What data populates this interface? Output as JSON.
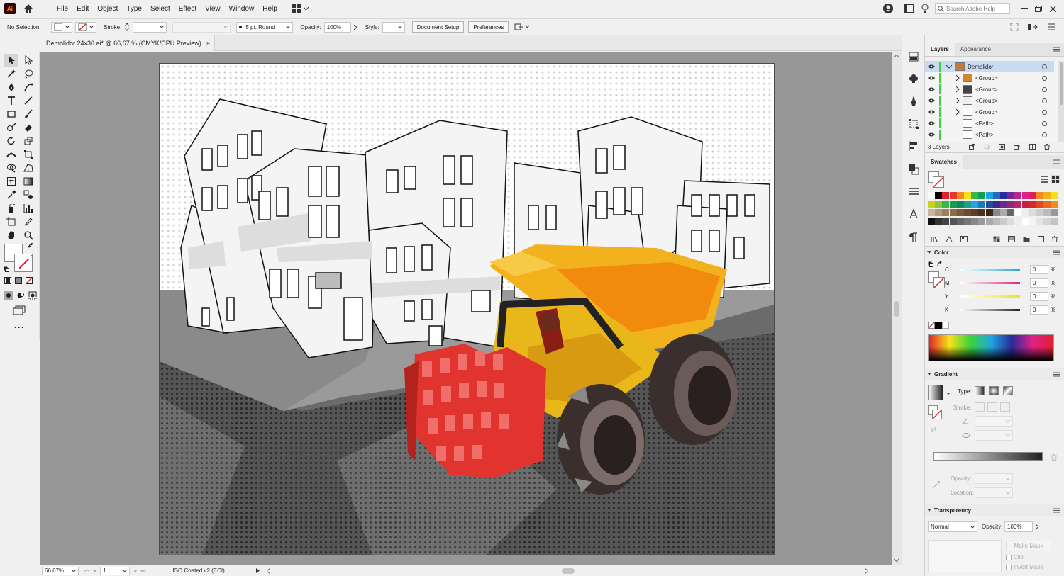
{
  "app": {
    "logo": "Ai"
  },
  "menu": [
    "File",
    "Edit",
    "Object",
    "Type",
    "Select",
    "Effect",
    "View",
    "Window",
    "Help"
  ],
  "search": {
    "placeholder": "Search Adobe Help"
  },
  "control": {
    "selection": "No Selection",
    "stroke_label": "Stroke:",
    "brush": "5 pt. Round",
    "opacity_label": "Opacity:",
    "opacity": "100%",
    "style_label": "Style:",
    "doc_setup": "Document Setup",
    "preferences": "Preferences"
  },
  "document": {
    "tab_title": "Demolidor 24x30.ai* @ 66,67 % (CMYK/CPU Preview)",
    "close": "×"
  },
  "status": {
    "zoom": "66,67%",
    "artboard": "1",
    "profile": "ISO Coated v2 (ECI)"
  },
  "layers_panel": {
    "tabs": [
      "Layers",
      "Appearance"
    ],
    "rows": [
      {
        "name": "Demolidor"
      },
      {
        "name": "<Group>"
      },
      {
        "name": "<Group>"
      },
      {
        "name": "<Group>"
      },
      {
        "name": "<Group>"
      },
      {
        "name": "<Path>"
      },
      {
        "name": "<Path>"
      }
    ],
    "count": "3 Layers"
  },
  "swatches_panel": {
    "title": "Swatches"
  },
  "color_panel": {
    "title": "Color",
    "channels": [
      {
        "label": "C",
        "value": "0",
        "unit": "%",
        "color": "#1fa6e0"
      },
      {
        "label": "M",
        "value": "0",
        "unit": "%",
        "color": "#e0218a"
      },
      {
        "label": "Y",
        "value": "0",
        "unit": "%",
        "color": "#f2e21a"
      },
      {
        "label": "K",
        "value": "0",
        "unit": "%",
        "color": "#222222"
      }
    ]
  },
  "gradient_panel": {
    "title": "Gradient",
    "type_label": "Type:",
    "stroke_label": "Stroke:",
    "opacity_label": "Opacity:",
    "location_label": "Location:"
  },
  "transparency_panel": {
    "title": "Transparency",
    "blend": "Normal",
    "opacity_label": "Opacity:",
    "opacity": "100%",
    "make_mask": "Make Mask",
    "clip": "Clip",
    "invert": "Invert Mask"
  },
  "colors": {
    "accent": "#1473e6",
    "layer_green": "#3cd33c",
    "artboard_bg": "#ffffff",
    "pasteboard": "#979797"
  }
}
